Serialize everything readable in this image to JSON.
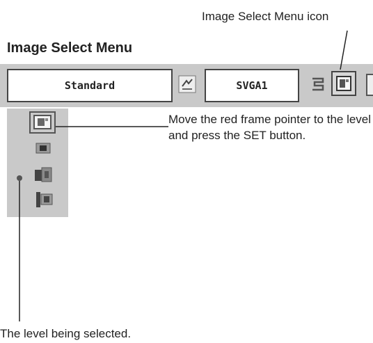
{
  "header": {
    "menu_icon_callout": "Image Select Menu icon",
    "section_title": "Image Select Menu"
  },
  "menu_bar": {
    "mode_value": "Standard",
    "source_value": "SVGA1"
  },
  "side_panel": {
    "selected_level": 3,
    "level_count": 4
  },
  "callouts": {
    "pointer_instruction": "Move the red frame pointer to the level and press the SET button.",
    "selected_level_note": "The level being selected."
  },
  "icons": {
    "mode_arrow": "cycle-icon",
    "source_toggle": "input-switch-icon",
    "image_select": "image-select-icon",
    "levels": [
      "level-1-icon",
      "level-2-icon",
      "level-3-icon",
      "level-4-icon"
    ]
  }
}
